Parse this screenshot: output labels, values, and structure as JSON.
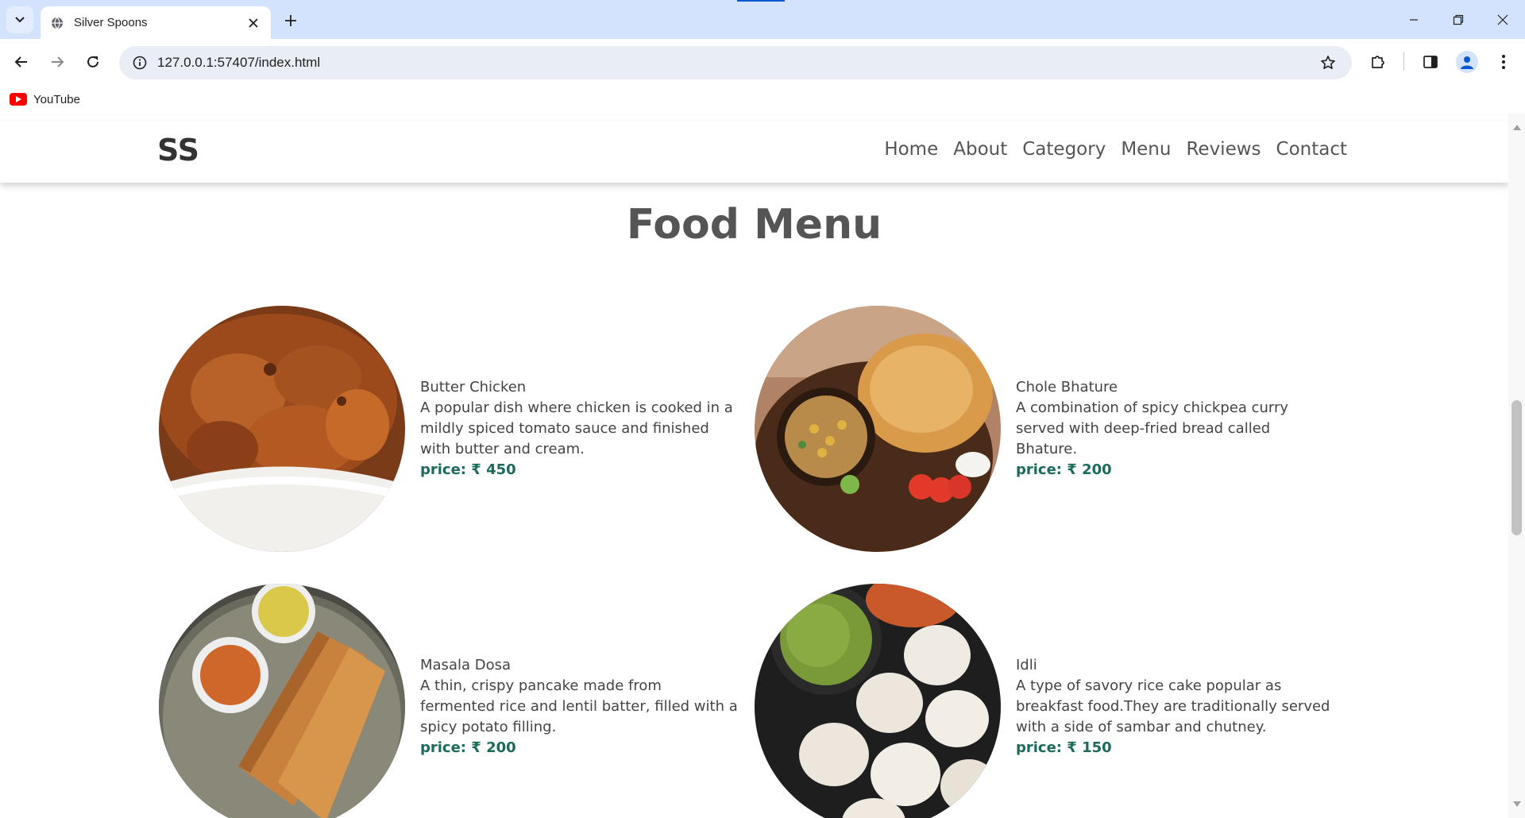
{
  "browser": {
    "tab_title": "Silver Spoons",
    "url": "127.0.0.1:57407/index.html",
    "bookmarks": [
      {
        "label": "YouTube",
        "icon": "youtube-icon"
      }
    ]
  },
  "site": {
    "logo": "SS",
    "nav": [
      "Home",
      "About",
      "Category",
      "Menu",
      "Reviews",
      "Contact"
    ]
  },
  "section": {
    "title": "Food Menu"
  },
  "menu": [
    {
      "name": "Butter Chicken",
      "description": "A popular dish where chicken is cooked in a mildly spiced tomato sauce and finished with butter and cream.",
      "price": "price: ₹ 450"
    },
    {
      "name": "Chole Bhature",
      "description": "A combination of spicy chickpea curry served with deep-fried bread called Bhature.",
      "price": "price: ₹ 200"
    },
    {
      "name": "Masala Dosa",
      "description": "A thin, crispy pancake made from fermented rice and lentil batter, filled with a spicy potato filling.",
      "price": "price: ₹ 200"
    },
    {
      "name": "Idli",
      "description": "A type of savory rice cake popular as breakfast food.They are traditionally served with a side of sambar and chutney.",
      "price": "price: ₹ 150"
    }
  ],
  "colors": {
    "price": "#1b6b5d",
    "heading": "#555555",
    "tabbar": "#d3e3fd"
  }
}
